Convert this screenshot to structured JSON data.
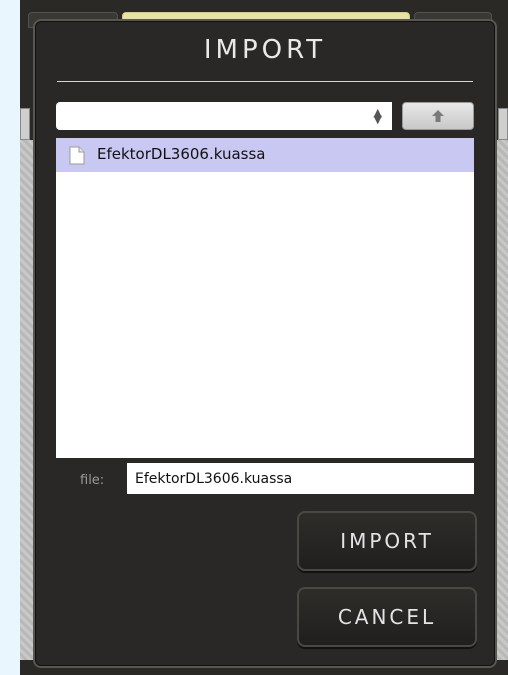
{
  "dialog": {
    "title": "IMPORT",
    "path_select": {
      "value": ""
    },
    "up_button": {
      "icon": "arrow-up-icon"
    },
    "file_list": {
      "items": [
        {
          "name": "EfektorDL3606.kuassa",
          "icon": "document-icon",
          "selected": true
        }
      ]
    },
    "file_field": {
      "label": "file:",
      "value": "EfektorDL3606.kuassa"
    },
    "buttons": {
      "import_label": "IMPORT",
      "cancel_label": "CANCEL"
    }
  },
  "colors": {
    "dialog_bg": "#2a2826",
    "selection": "#c9c8f2",
    "page_bg": "#eaf6fd"
  }
}
